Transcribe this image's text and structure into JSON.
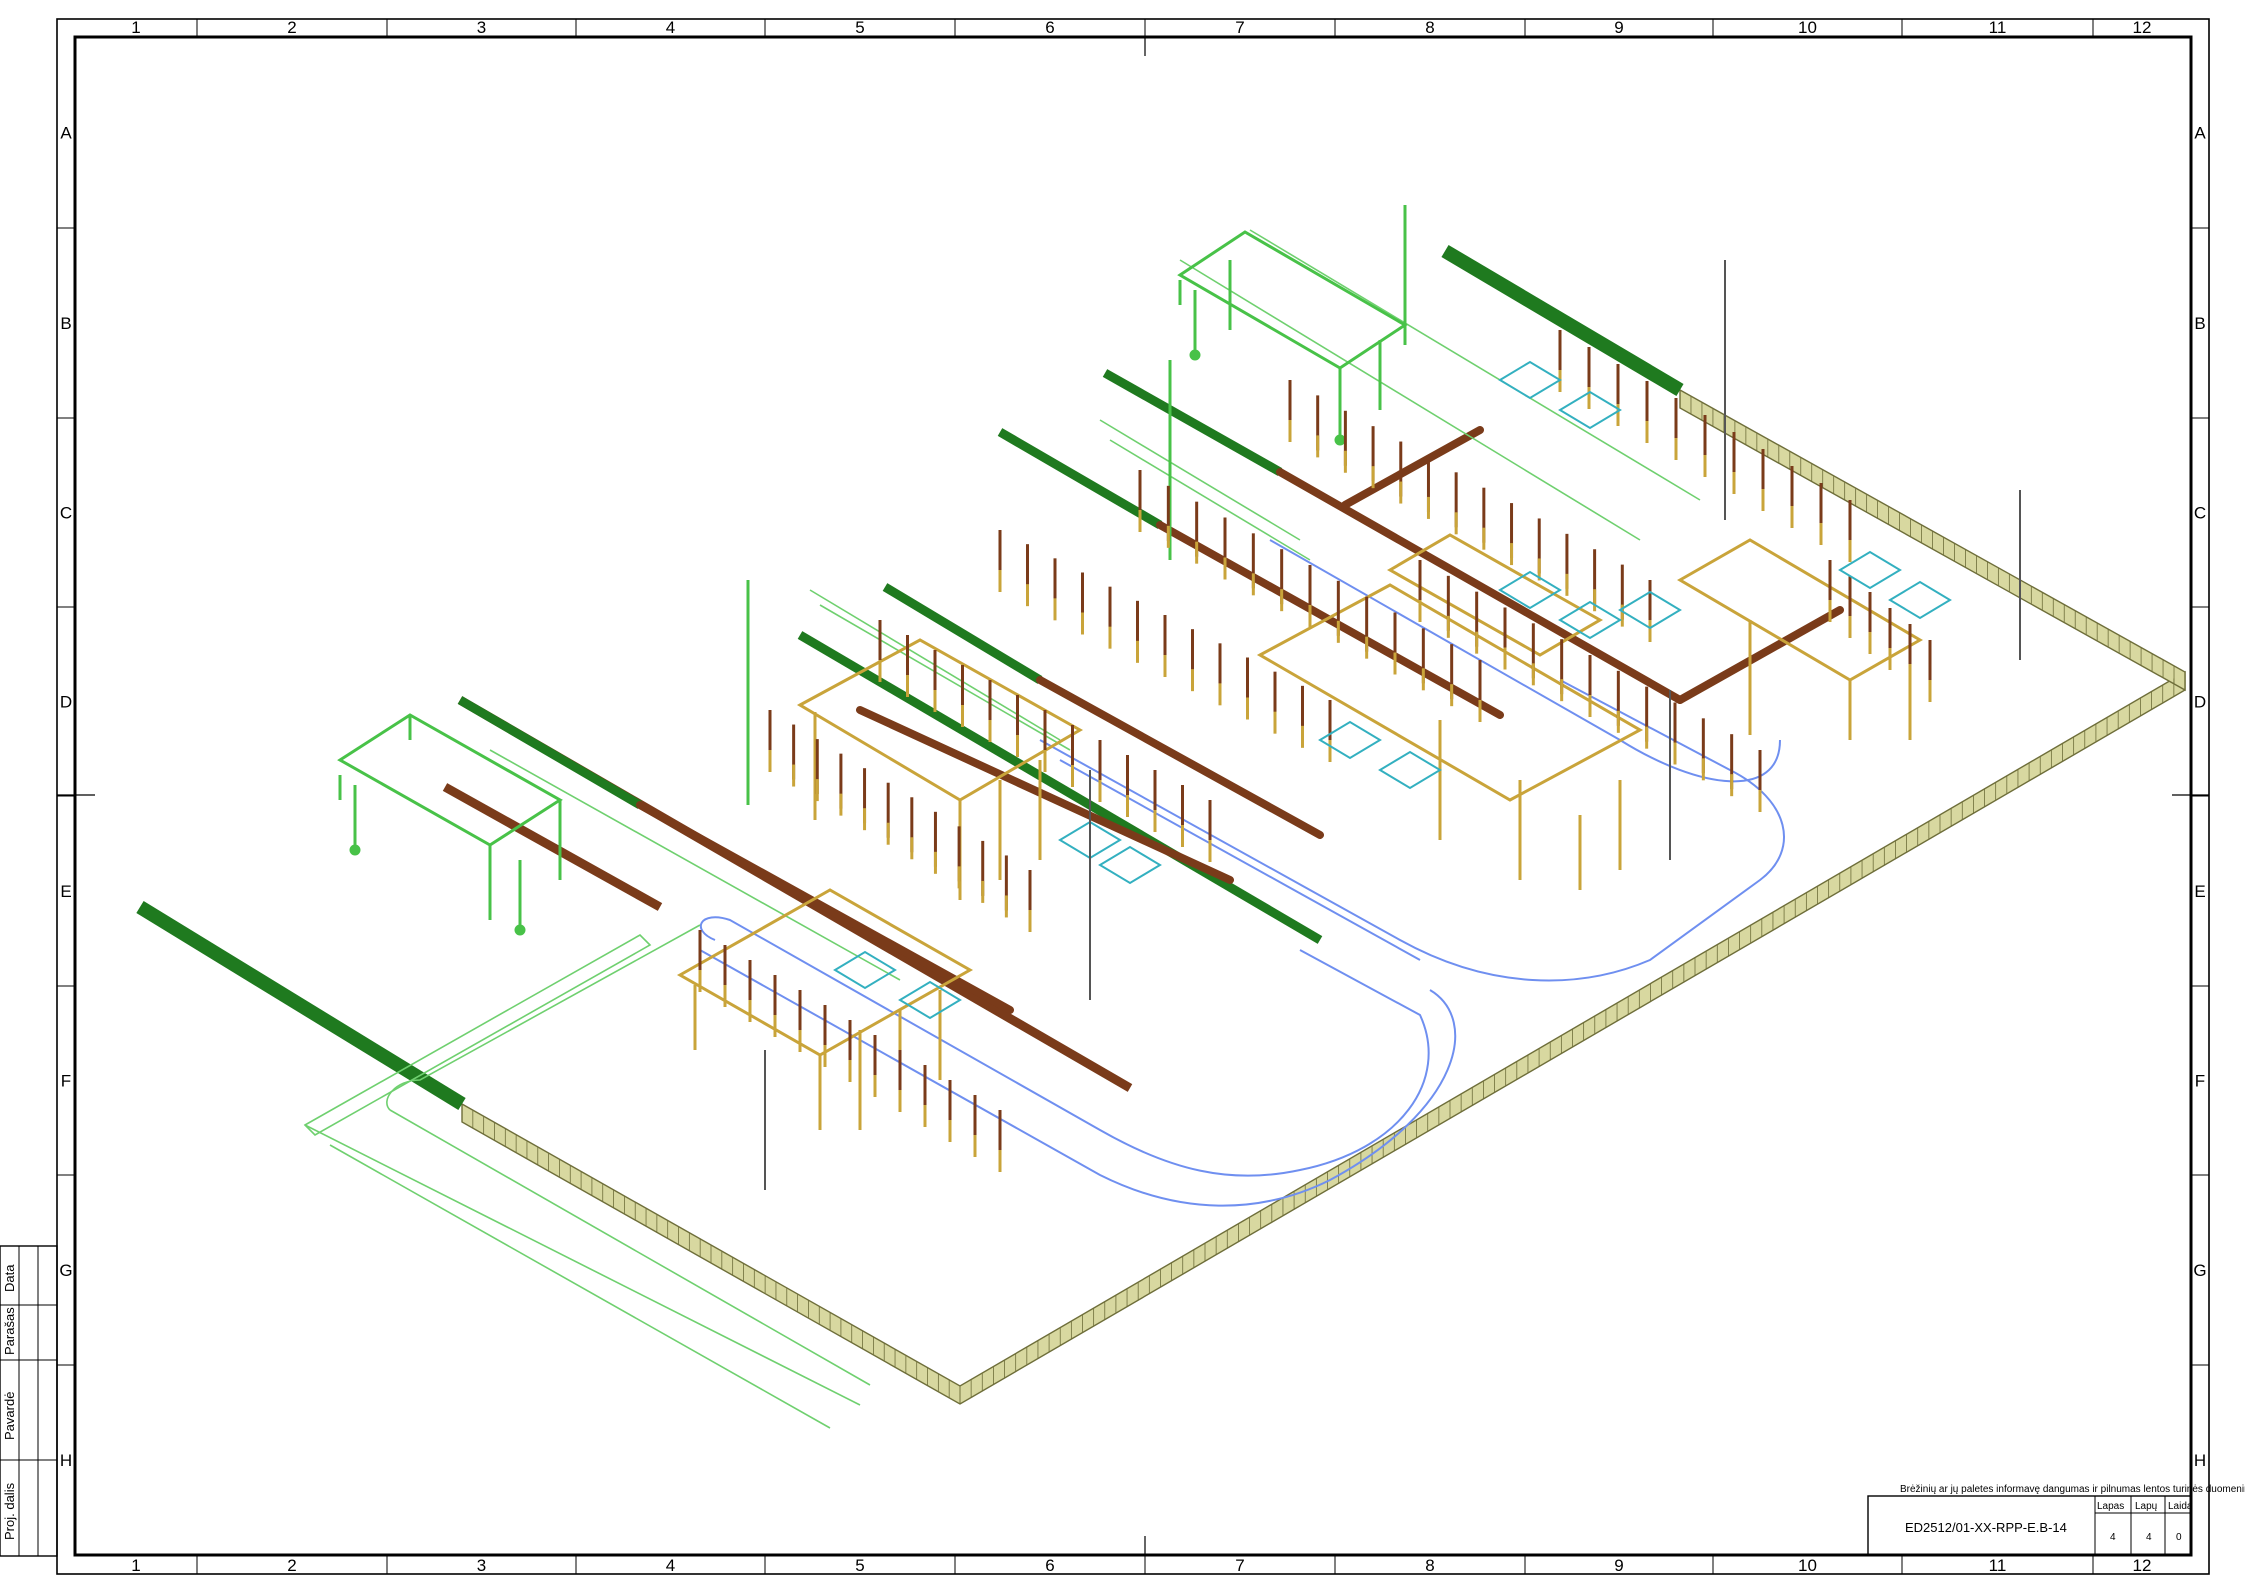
{
  "sheet": {
    "column_labels": [
      "1",
      "2",
      "3",
      "4",
      "5",
      "6",
      "7",
      "8",
      "9",
      "10",
      "11",
      "12"
    ],
    "row_labels": [
      "A",
      "B",
      "C",
      "D",
      "E",
      "F",
      "G",
      "H"
    ]
  },
  "side_stamp": {
    "labels": [
      "Data",
      "Parašas",
      "Pavardė",
      "Proj. dalis"
    ]
  },
  "title_block": {
    "note": "Brėžinių ar jų paletes informavę dangumas ir pilnumas lentos turinės duomenimis",
    "drawing_number": "ED2512/01-XX-RPP-E.B-14",
    "sheet_label": "Lapas",
    "sheets_label": "Lapų",
    "revision_label": "Laida",
    "sheet_value": "4",
    "sheets_value": "4",
    "revision_value": "0"
  },
  "colors": {
    "frame": "#000000",
    "fence": "#c8c890",
    "busbar": "#7a3b1a",
    "cable_hedge": "#2f8f2f",
    "road": "#6f8ff0",
    "portal_green": "#48c248",
    "gantry_gold": "#c9a43a",
    "equipment_teal": "#33b0c0"
  }
}
